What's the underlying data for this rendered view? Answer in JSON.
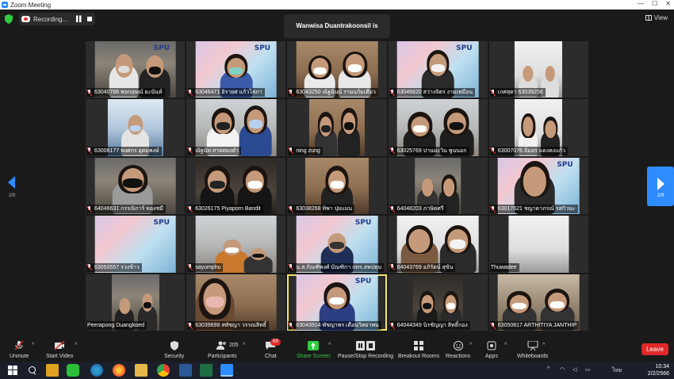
{
  "window": {
    "title": "Zoom Meeting"
  },
  "topbar": {
    "recording_label": "Recording...",
    "talking": "Wanwisa Duantrakoonsil is talking...",
    "view_label": "View"
  },
  "navigation": {
    "left_page": "2/9",
    "right_page": "2/9"
  },
  "participants": [
    {
      "name": "63040786 พลกฤษณ์ ยะนันท์"
    },
    {
      "name": "63046471 อิรายศ แก้วไสภา"
    },
    {
      "name": "63043250 ณัฐฉันน์ รามแก้มเคียว"
    },
    {
      "name": "63046820 สว่างจิตร งามเหมือน"
    },
    {
      "name": "เกศสุดา 63039256"
    },
    {
      "name": "63006177 พงศกร อุดมพงษ์"
    },
    {
      "name": "ณัฐนัท สายทองคำ"
    },
    {
      "name": "ning zung"
    },
    {
      "name": "63025769 ปานมะวิน พูนนอก"
    },
    {
      "name": "63007076 อิ่มอร แดงคงแก้ว"
    },
    {
      "name": "64046631 กรรณิการ์ ทองชมี"
    },
    {
      "name": "63026175 Piyaporn Bandit"
    },
    {
      "name": "63038268 ทิพา ปุยแมน"
    },
    {
      "name": "64048203 ภาษิตศรี"
    },
    {
      "name": "63017621 ชญาดาภรณ์ รสกิวนะ"
    },
    {
      "name": "63050557 รวงข้าว"
    },
    {
      "name": "sayumphu"
    },
    {
      "name": "น.ส.กัณฑิพงศ์ บัณฑิกา กทร.สหปทุม"
    },
    {
      "name": "64043769 อภิรัตน์ สุขัน"
    },
    {
      "name": "Thuwadee"
    },
    {
      "name": "Peerapong Duangkoed"
    },
    {
      "name": "63039698 สพัชญา วรรณสิทธิ์"
    },
    {
      "name": "63043914 พัชญาพร เดือนวิทยาพน"
    },
    {
      "name": "64044349 นิรชัญญา สิทธิ์กอง"
    },
    {
      "name": "63050817 ARTHITIYA JANTHIP"
    }
  ],
  "toolbar": {
    "unmute": "Unmute",
    "start_video": "Start Video",
    "security": "Security",
    "participants": "Participants",
    "participants_count": "205",
    "chat": "Chat",
    "chat_badge": "69",
    "share_screen": "Share Screen",
    "pause_recording": "Pause/Stop Recording",
    "breakout_rooms": "Breakout Rooms",
    "reactions": "Reactions",
    "apps": "Apps",
    "whiteboards": "Whiteboards",
    "leave": "Leave"
  },
  "taskbar": {
    "time": "10:34",
    "date": "2/2/2566",
    "language": "ไทย"
  },
  "colors": {
    "accent": "#2d8cff",
    "leave": "#e02828",
    "active_speaker": "#f3e26a",
    "share_green": "#2ecc40"
  }
}
